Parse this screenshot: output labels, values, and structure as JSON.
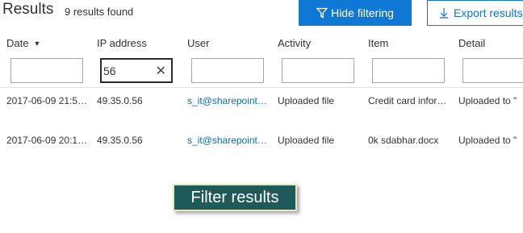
{
  "header": {
    "title": "Results",
    "count": "9 results found",
    "hide_filtering": "Hide filtering",
    "export_results": "Export results"
  },
  "columns": [
    {
      "label": "Date",
      "sorted": true
    },
    {
      "label": "IP address"
    },
    {
      "label": "User"
    },
    {
      "label": "Activity"
    },
    {
      "label": "Item"
    },
    {
      "label": "Detail"
    }
  ],
  "filters": {
    "date": "",
    "ip_address": "56",
    "user": "",
    "activity": "",
    "item": "",
    "detail": ""
  },
  "rows": [
    {
      "date": "2017-06-09 21:5…",
      "ip": "49.35.0.56",
      "user": "s_it@sharepoint…",
      "activity": "Uploaded file",
      "item": "Credit card infor…",
      "detail": "Uploaded to \""
    },
    {
      "date": "2017-06-09 20:1…",
      "ip": "49.35.0.56",
      "user": "s_it@sharepoint…",
      "activity": "Uploaded file",
      "item": "0k sdabhar.docx",
      "detail": "Uploaded to \""
    }
  ],
  "annotation": "Filter results",
  "icons": {
    "filter": "funnel-icon",
    "export": "download-arrow-icon",
    "sort": "sort-down-icon",
    "clear": "clear-x-icon"
  },
  "colors": {
    "accent": "#0f78d4",
    "link": "#0f6cbd",
    "tooltip_bg": "#1f5a5a"
  }
}
